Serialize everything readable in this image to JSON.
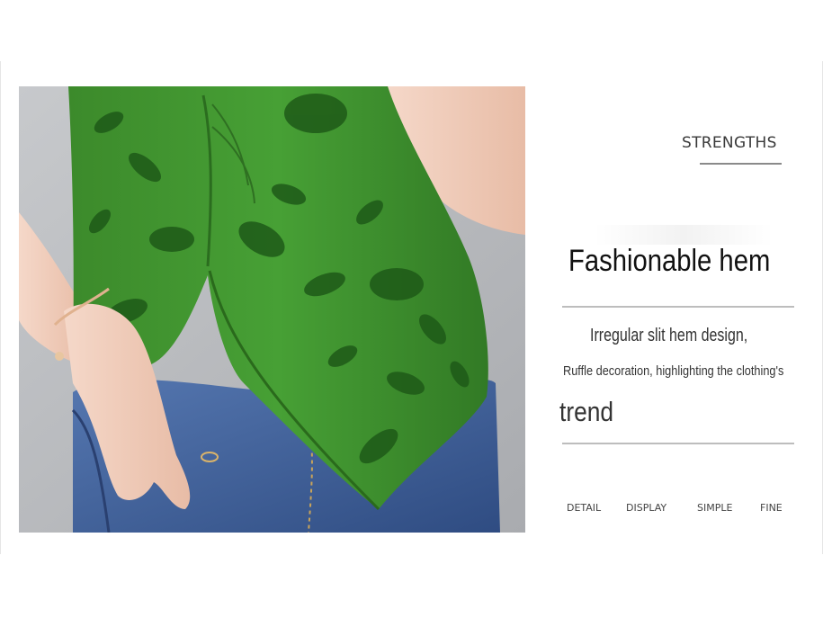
{
  "header": {
    "label": "STRENGTHS"
  },
  "feature": {
    "title": "Fashionable hem",
    "line1": "Irregular slit hem design,",
    "line2": "Ruffle decoration, highlighting the clothing's",
    "line3": "trend"
  },
  "tags": [
    "DETAIL",
    "DISPLAY",
    "SIMPLE",
    "FINE"
  ],
  "photo": {
    "subject": "green floral mesh top with slit hem over blue jeans"
  },
  "colors": {
    "top_green": "#3f8f2f",
    "print_green": "#1f5a1a",
    "denim": "#3f5f98",
    "skin": "#f2d1c0",
    "backdrop": "#b9bbbe"
  }
}
